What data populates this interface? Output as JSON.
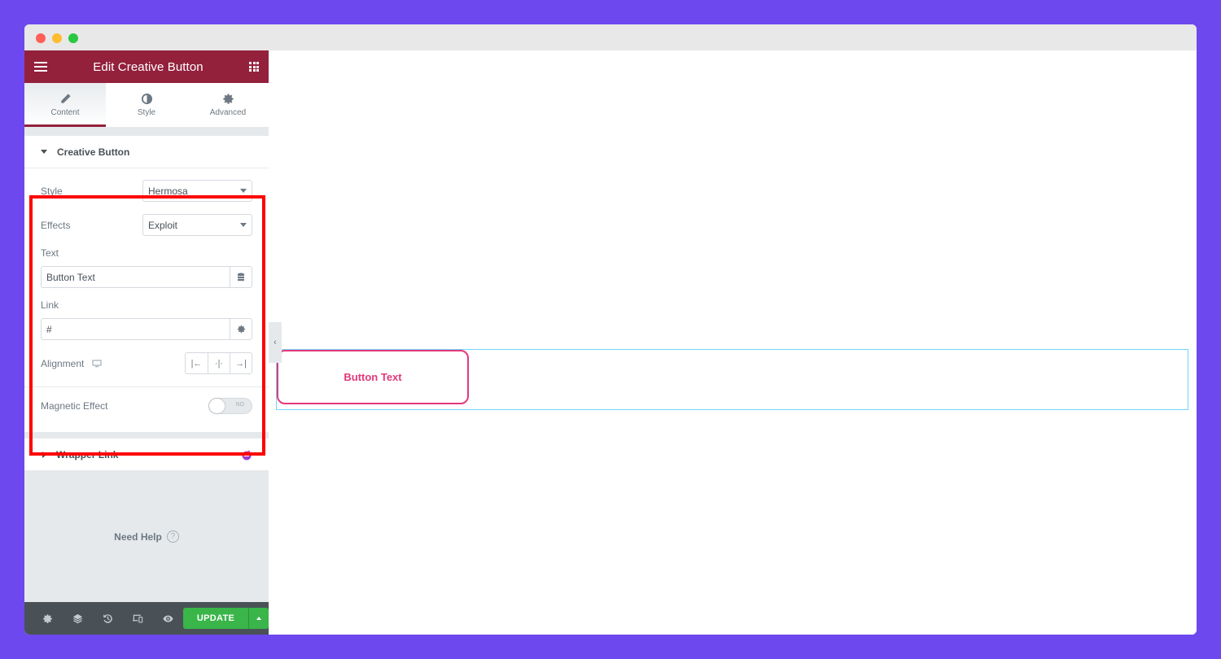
{
  "window": {
    "traffic_lights": [
      "close",
      "minimize",
      "maximize"
    ]
  },
  "panel": {
    "header_title": "Edit Creative Button",
    "menu_icon": "hamburger-icon",
    "apps_icon": "grid-icon",
    "tabs": [
      {
        "label": "Content",
        "icon": "pencil-icon",
        "active": true
      },
      {
        "label": "Style",
        "icon": "half-circle-icon",
        "active": false
      },
      {
        "label": "Advanced",
        "icon": "gear-icon",
        "active": false
      }
    ],
    "section_creative_button": {
      "title": "Creative Button",
      "expanded": true,
      "controls": {
        "style": {
          "label": "Style",
          "value": "Hermosa"
        },
        "effects": {
          "label": "Effects",
          "value": "Exploit"
        },
        "text": {
          "label": "Text",
          "value": "Button Text"
        },
        "link": {
          "label": "Link",
          "value": "#"
        },
        "alignment": {
          "label": "Alignment",
          "options": [
            "left",
            "center",
            "right"
          ]
        },
        "magnetic_effect": {
          "label": "Magnetic Effect",
          "toggle_label": "NO",
          "enabled": false
        }
      }
    },
    "section_wrapper_link": {
      "title": "Wrapper Link",
      "expanded": false
    },
    "help_label": "Need Help",
    "help_icon": "?",
    "footer": {
      "update_label": "UPDATE",
      "icons": [
        "settings-icon",
        "layers-icon",
        "history-icon",
        "responsive-icon",
        "preview-icon"
      ]
    }
  },
  "canvas": {
    "button_text": "Button Text",
    "accent_color": "#e4387a"
  },
  "colors": {
    "header": "#93213c",
    "update": "#39b54a",
    "highlight": "#ff0000",
    "background": "#6d48ee"
  }
}
